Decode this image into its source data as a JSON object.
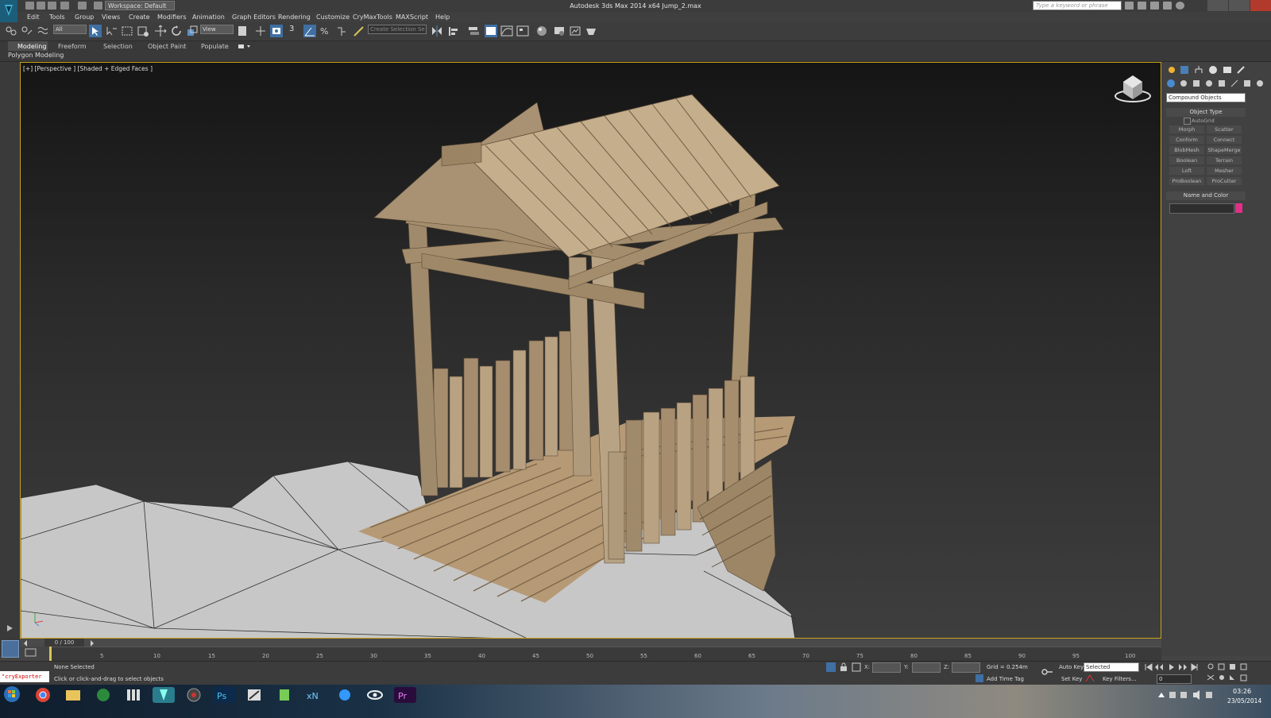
{
  "window": {
    "title": "Autodesk 3ds Max 2014 x64     Jump_2.max",
    "workspace": "Workspace: Default",
    "search_placeholder": "Type a keyword or phrase"
  },
  "menu": [
    "Edit",
    "Tools",
    "Group",
    "Views",
    "Create",
    "Modifiers",
    "Animation",
    "Graph Editors",
    "Rendering",
    "Customize",
    "CryMaxTools",
    "MAXScript",
    "Help"
  ],
  "toolbar": {
    "selection_filter": "All",
    "ref_coord": "View",
    "named_selection": "Create Selection Se",
    "snap_angle": "3"
  },
  "ribbon": {
    "tabs": [
      "Modeling",
      "Freeform",
      "Selection",
      "Object Paint",
      "Populate"
    ],
    "sub_label": "Polygon Modeling"
  },
  "viewport": {
    "label": "[+] [Perspective ] [Shaded + Edged Faces ]"
  },
  "command_panel": {
    "category": "Compound Objects",
    "object_type_title": "Object Type",
    "autogrid": "AutoGrid",
    "buttons": [
      "Morph",
      "Scatter",
      "Conform",
      "Connect",
      "BlobMesh",
      "ShapeMerge",
      "Boolean",
      "Terrain",
      "Loft",
      "Mesher",
      "ProBoolean",
      "ProCutter"
    ],
    "name_color_title": "Name and Color",
    "object_color": "#e0308a"
  },
  "timeline": {
    "frame": "0 / 100",
    "ticks": [
      "5",
      "10",
      "15",
      "20",
      "25",
      "30",
      "35",
      "40",
      "45",
      "50",
      "55",
      "60",
      "65",
      "70",
      "75",
      "80",
      "85",
      "90",
      "95",
      "100"
    ]
  },
  "status": {
    "maxscript": "\"cryExporter",
    "selection": "None Selected",
    "prompt": "Click or click-and-drag to select objects",
    "x_label": "X:",
    "y_label": "Y:",
    "z_label": "Z:",
    "grid": "Grid = 0.254m",
    "add_time_tag": "Add Time Tag",
    "auto_key": "Auto Key",
    "set_key": "Set Key",
    "selected": "Selected",
    "key_filters": "Key Filters...",
    "frame_value": "0"
  },
  "taskbar": {
    "time": "03:26",
    "date": "23/05/2014"
  }
}
